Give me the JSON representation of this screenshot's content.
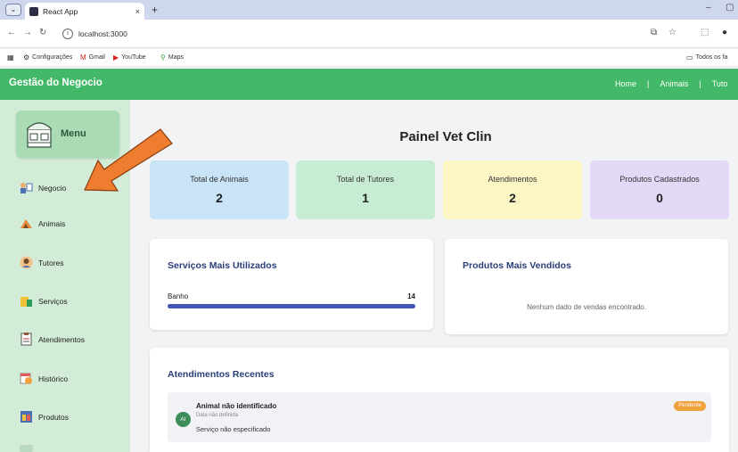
{
  "browser": {
    "tab_title": "React App",
    "tab_close": "×",
    "new_tab": "+",
    "url": "localhost:3000",
    "bookmarks": [
      "Configurações",
      "Gmail",
      "YouTube",
      "Maps"
    ],
    "all_bookmarks": "Todos os fa"
  },
  "header": {
    "title": "Gestão do Negocio",
    "nav": [
      "Home",
      "|",
      "Animais",
      "|",
      "Tuto"
    ]
  },
  "sidebar": {
    "menu_label": "Menu",
    "items": [
      {
        "label": "Negocio",
        "icon": "business-icon"
      },
      {
        "label": "Animais",
        "icon": "animals-icon"
      },
      {
        "label": "Tutores",
        "icon": "tutors-icon"
      },
      {
        "label": "Serviços",
        "icon": "services-icon"
      },
      {
        "label": "Atendimentos",
        "icon": "appointments-icon"
      },
      {
        "label": "Histórico",
        "icon": "history-icon"
      },
      {
        "label": "Produtos",
        "icon": "products-icon"
      }
    ]
  },
  "main": {
    "title": "Painel Vet Clin",
    "stats": [
      {
        "label": "Total de Animais",
        "value": "2",
        "color": "#c9e3f7"
      },
      {
        "label": "Total de Tutores",
        "value": "1",
        "color": "#c7ebd3"
      },
      {
        "label": "Atendimentos",
        "value": "2",
        "color": "#fbf6c4"
      },
      {
        "label": "Produtos Cadastrados",
        "value": "0",
        "color": "#e3d9f7"
      }
    ],
    "services": {
      "title": "Serviços Mais Utilizados",
      "items": [
        {
          "label": "Banho",
          "value": "14",
          "fill_fraction": 1.0
        }
      ]
    },
    "products": {
      "title": "Produtos Mais Vendidos",
      "empty": "Nenhum dado de vendas encontrado."
    },
    "recent": {
      "title": "Atendimentos Recentes",
      "items": [
        {
          "avatar": "AI",
          "name": "Animal não identificado",
          "date": "Data não definida",
          "service": "Serviço não especificado",
          "status": "Pendente"
        }
      ]
    }
  },
  "colors": {
    "header": "#43b869",
    "sidebar": "#d3ecd8",
    "accent": "#4355b5",
    "badge": "#f0a13c",
    "arrow": "#ef7d2f"
  }
}
